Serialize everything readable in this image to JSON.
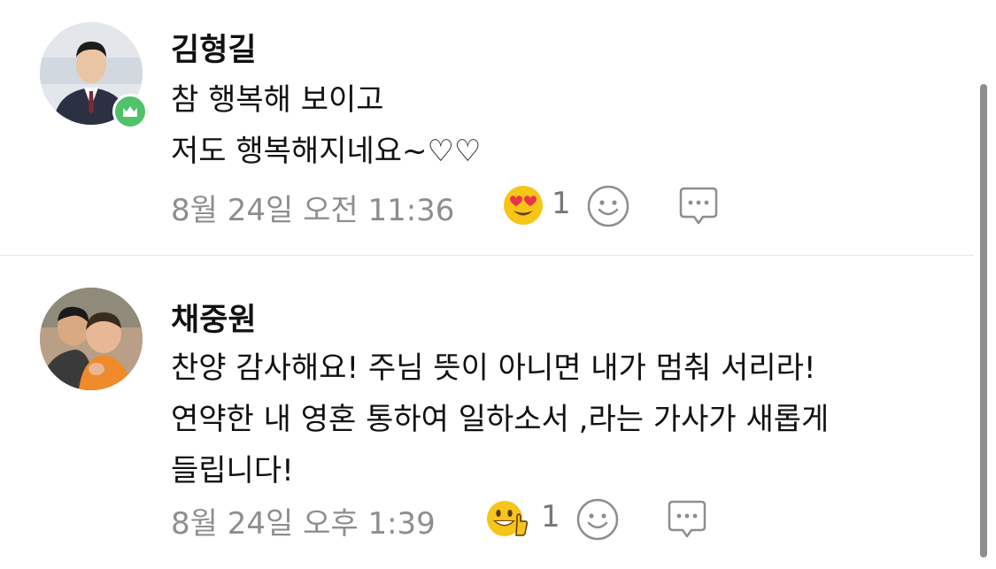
{
  "comments": [
    {
      "author": "김형길",
      "lines": [
        "참 행복해 보이고",
        "저도 행복해지네요~♡♡"
      ],
      "date": "8월 24일 오전 11:36",
      "reaction": {
        "emoji": "heart-eyes-face",
        "count": "1"
      },
      "badge": "crown",
      "badge_color": "#4fc26a"
    },
    {
      "author": "채중원",
      "lines": [
        "찬양 감사해요! 주님 뜻이 아니면 내가 멈춰 서리라!",
        "연약한 내 영혼 통하여 일하소서 ,라는 가사가 새롭게",
        "들립니다!"
      ],
      "date": "8월 24일 오후 1:39",
      "reaction": {
        "emoji": "grinning-thumbs-up-face",
        "count": "1"
      }
    }
  ],
  "colors": {
    "text": "#111111",
    "meta": "#8e8e8e",
    "divider": "#e6e6e6",
    "emoji_yellow": "#f5c518"
  }
}
